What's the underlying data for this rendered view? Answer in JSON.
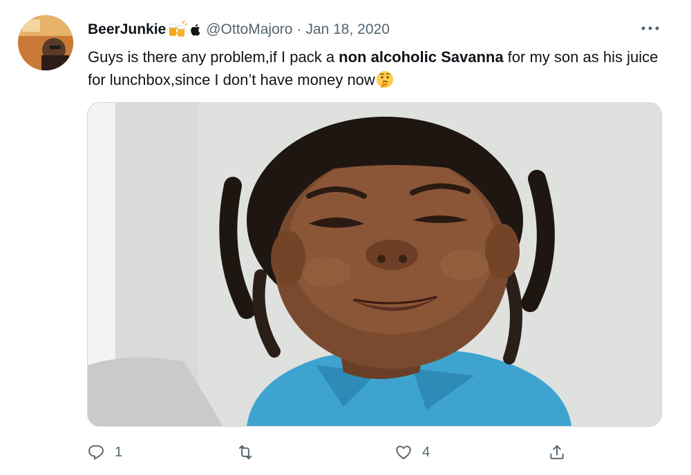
{
  "tweet": {
    "author": {
      "display_name": "BeerJunkie",
      "name_emoji_icon": "beer-mugs-icon",
      "badge_icon": "apple-icon",
      "handle": "@OttoMajoro",
      "separator": "·",
      "date": "Jan 18, 2020"
    },
    "text": {
      "part1": "Guys is there any problem,if I pack a ",
      "bold": "non alcoholic Savanna",
      "part2": " for my son as his juice for lunchbox,since I don’t have money now",
      "trailing_emoji_icon": "thinking-face-icon"
    },
    "media": {
      "alt_icon": "photo-of-smiling-child"
    },
    "actions": {
      "reply": {
        "icon": "reply-icon",
        "count": "1"
      },
      "retweet": {
        "icon": "retweet-icon",
        "count": ""
      },
      "like": {
        "icon": "heart-icon",
        "count": "4"
      },
      "share": {
        "icon": "share-icon"
      }
    },
    "colors": {
      "text": "#0f1419",
      "secondary": "#536471",
      "border": "#cfd9de",
      "shirt": "#3fa3cf"
    }
  }
}
